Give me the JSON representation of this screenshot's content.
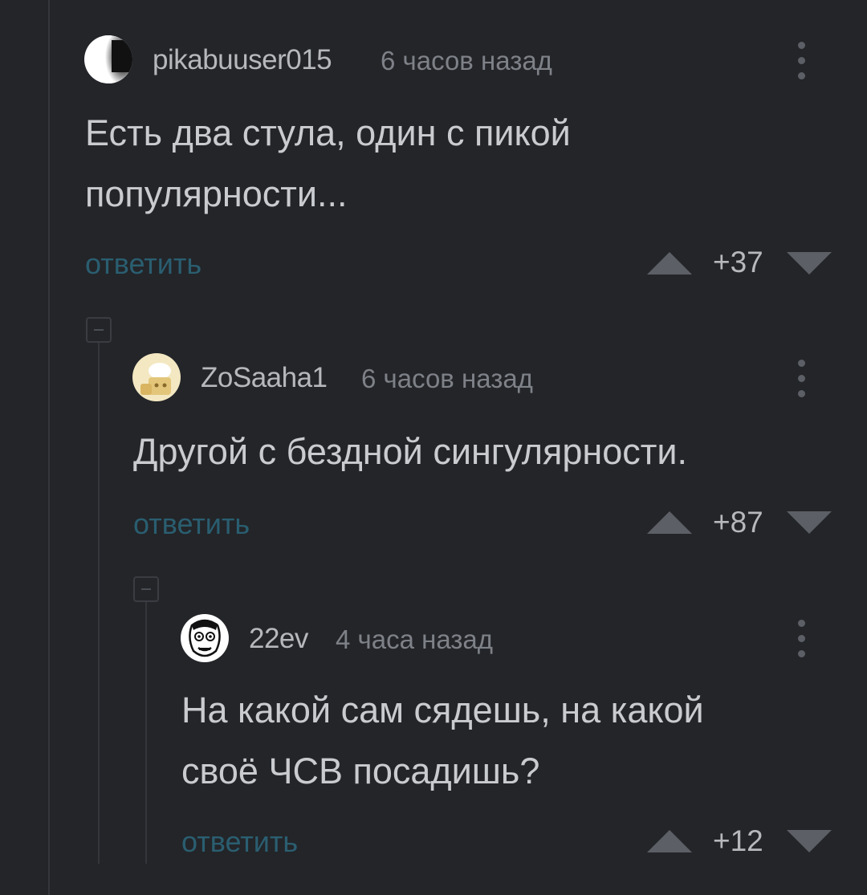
{
  "comments": [
    {
      "username": "pikabuuser015",
      "time": "6 часов назад",
      "text": "Есть два стула, один с пикой\nпопулярности...",
      "reply_label": "ответить",
      "rating": "+37"
    },
    {
      "username": "ZoSaaha1",
      "time": "6 часов назад",
      "text": "Другой с бездной сингулярности.",
      "reply_label": "ответить",
      "rating": "+87"
    },
    {
      "username": "22ev",
      "time": "4 часа назад",
      "text": "На какой сам сядешь, на какой\nсвоё ЧСВ посадишь?",
      "reply_label": "ответить",
      "rating": "+12"
    }
  ],
  "colors": {
    "background": "#232529",
    "reply_link": "#2a5e70",
    "text": "#c9cbcf",
    "meta": "#7e8187",
    "arrows": "#5c5f65"
  },
  "icons": {
    "more": "vertical-ellipsis-icon",
    "upvote": "triangle-up-icon",
    "downvote": "triangle-down-icon",
    "collapse": "minus-square-icon"
  }
}
